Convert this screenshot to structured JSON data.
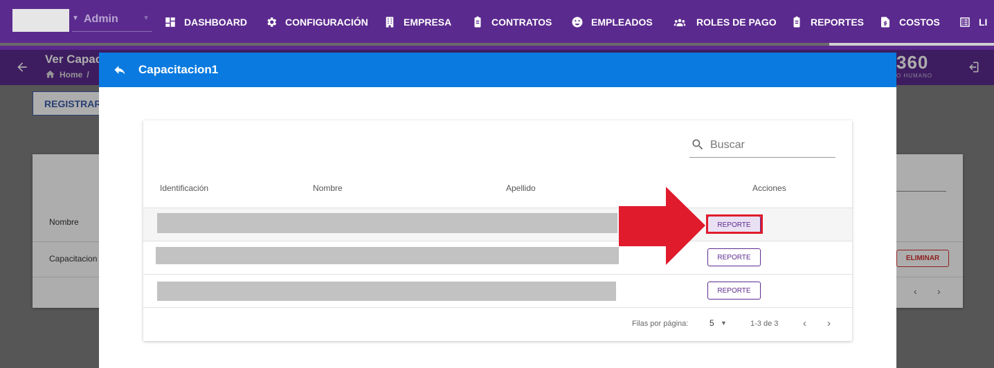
{
  "topnav": {
    "user_label": "Admin",
    "items": [
      {
        "label": "DASHBOARD",
        "icon": "dashboard-icon"
      },
      {
        "label": "CONFIGURACIÓN",
        "icon": "gear-icon"
      },
      {
        "label": "EMPRESA",
        "icon": "building-icon"
      },
      {
        "label": "CONTRATOS",
        "icon": "clipboard-icon"
      },
      {
        "label": "EMPLEADOS",
        "icon": "face-icon"
      },
      {
        "label": "ROLES DE PAGO",
        "icon": "people-icon"
      },
      {
        "label": "REPORTES",
        "icon": "clipboard-icon"
      },
      {
        "label": "COSTOS",
        "icon": "document-dollar-icon"
      },
      {
        "label": "LI",
        "icon": "list-icon"
      }
    ]
  },
  "subheader": {
    "title": "Ver Capac",
    "breadcrumb_home": "Home",
    "breadcrumb_sep": "/",
    "logo_text": "360",
    "logo_sub": "O HUMANO"
  },
  "background": {
    "register_label": "REGISTRAR C",
    "col_name": "Nombre",
    "row_name": "Capacitacion",
    "delete_label": "ELIMINAR"
  },
  "dialog": {
    "title": "Capacitacion1",
    "search_placeholder": "Buscar",
    "columns": [
      "Identificación",
      "Nombre",
      "Apellido",
      "Acciones"
    ],
    "rows": [
      {
        "action": "REPORTE"
      },
      {
        "action": "REPORTE"
      },
      {
        "action": "REPORTE"
      }
    ],
    "rows_per_page_label": "Filas por página:",
    "rows_per_page": "5",
    "range": "1-3 de 3"
  },
  "colors": {
    "nav_bg": "#5b2a8e",
    "dialog_bar": "#0a7ae0",
    "highlight": "#e01b2c"
  }
}
